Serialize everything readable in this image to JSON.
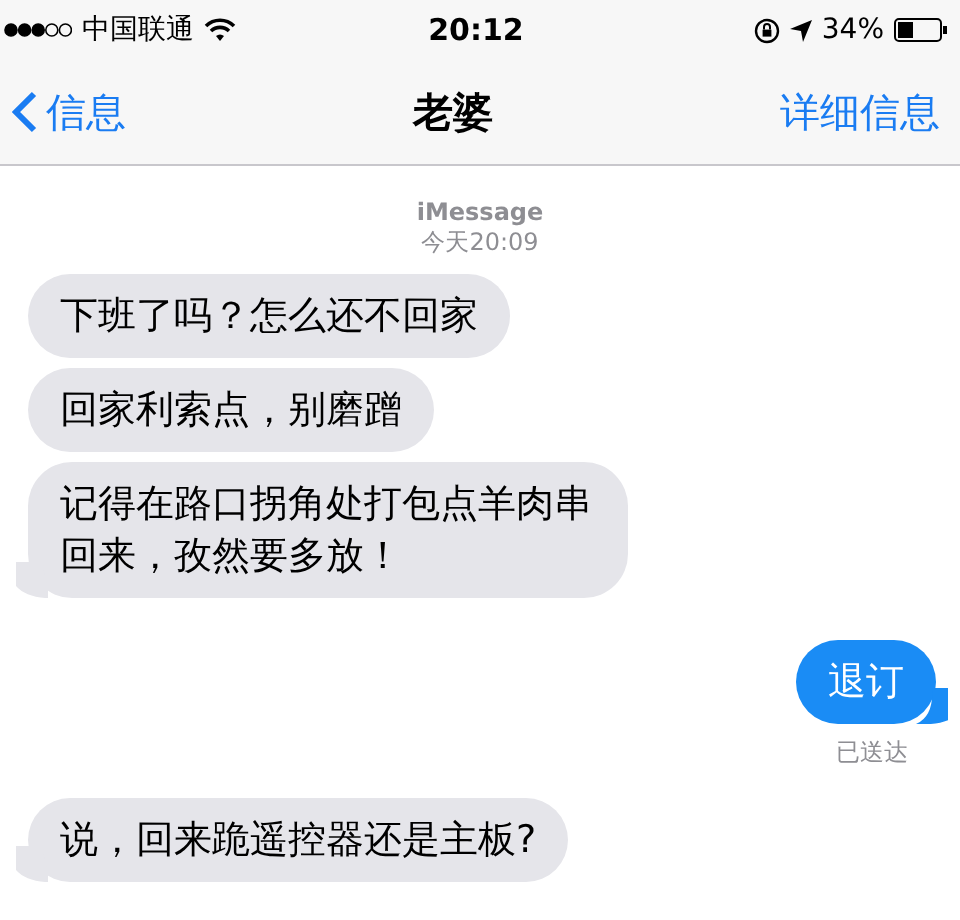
{
  "status_bar": {
    "carrier": "中国联通",
    "time": "20:12",
    "battery": "34%"
  },
  "nav": {
    "back": "信息",
    "title": "老婆",
    "details": "详细信息"
  },
  "header": {
    "service": "iMessage",
    "timestamp": "今天20:09"
  },
  "messages": [
    {
      "kind": "incoming",
      "text": "下班了吗？怎么还不回家",
      "tail": false
    },
    {
      "kind": "incoming",
      "text": "回家利索点，别磨蹭",
      "tail": false
    },
    {
      "kind": "incoming",
      "text": "记得在路口拐角处打包点羊肉串回来，孜然要多放！",
      "tail": true
    },
    {
      "kind": "outgoing",
      "text": "退订",
      "tail": true,
      "status": "已送达"
    },
    {
      "kind": "incoming",
      "text": "说，回来跪遥控器还是主板?",
      "tail": true
    }
  ]
}
